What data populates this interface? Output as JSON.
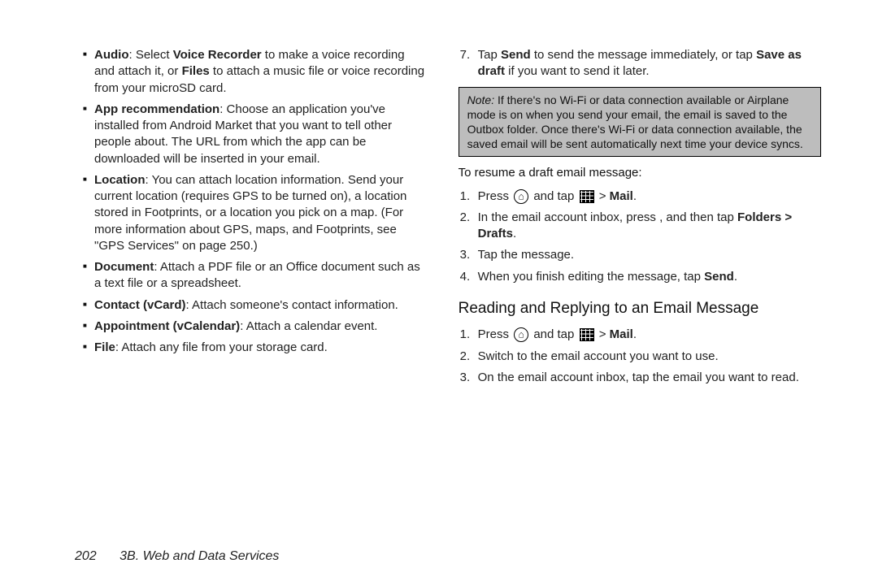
{
  "left": {
    "bullets": [
      {
        "label": "Audio",
        "pre": ": Select ",
        "bold1": "Voice Recorder",
        "mid": " to make a voice recording and attach it, or ",
        "bold2": "Files",
        "tail": " to attach a music file or voice recording from your microSD card."
      },
      {
        "label": "App recommendation",
        "tail": ": Choose an application you've installed from Android Market that you want to tell other people about. The URL from which the app can be downloaded will be inserted in your email."
      },
      {
        "label": "Location",
        "tail": ": You can attach location information. Send your current location (requires GPS to be turned on), a location stored in Footprints, or a location you pick on a map. (For more information about GPS, maps, and Footprints, see \"GPS Services\" on page 250.)"
      },
      {
        "label": "Document",
        "tail": ": Attach a PDF file or an Office document such as a text file or a spreadsheet."
      },
      {
        "label": "Contact (vCard)",
        "tail": ": Attach someone's contact information."
      },
      {
        "label": "Appointment (vCalendar)",
        "tail": ": Attach a calendar event."
      },
      {
        "label": "File",
        "tail": ": Attach any file from your storage card."
      }
    ]
  },
  "right": {
    "step7": {
      "num": "7.",
      "pre": "Tap ",
      "bold1": "Send",
      "mid": " to send the message immediately, or tap ",
      "bold2": "Save as draft",
      "tail": " if you want to send it later."
    },
    "note": {
      "label": "Note:",
      "text": " If there's no Wi-Fi or data connection available or Airplane mode is on when you send your email, the email is saved to the Outbox folder. Once there's Wi-Fi or data connection available, the saved email will be sent automatically next time your device syncs."
    },
    "resume_head": "To resume a draft email message:",
    "resume": [
      {
        "num": "1.",
        "pre": "Press ",
        "mid": " and tap ",
        "tail_pre": " > ",
        "bold": "Mail",
        "tail": "."
      },
      {
        "num": "2.",
        "pre": "In the email account inbox, press , and then tap ",
        "bold": "Folders > Drafts",
        "tail": "."
      },
      {
        "num": "3.",
        "text": "Tap the message."
      },
      {
        "num": "4.",
        "pre": "When you finish editing the message, tap ",
        "bold": "Send",
        "tail": "."
      }
    ],
    "section_head": "Reading and Replying to an Email Message",
    "reading": [
      {
        "num": "1.",
        "pre": "Press ",
        "mid": " and tap ",
        "tail_pre": " > ",
        "bold": "Mail",
        "tail": "."
      },
      {
        "num": "2.",
        "text": "Switch to the email account you want to use."
      },
      {
        "num": "3.",
        "text": "On the email account inbox, tap the email you want to read."
      }
    ]
  },
  "footer": {
    "page": "202",
    "chapter": "3B. Web and Data Services"
  }
}
